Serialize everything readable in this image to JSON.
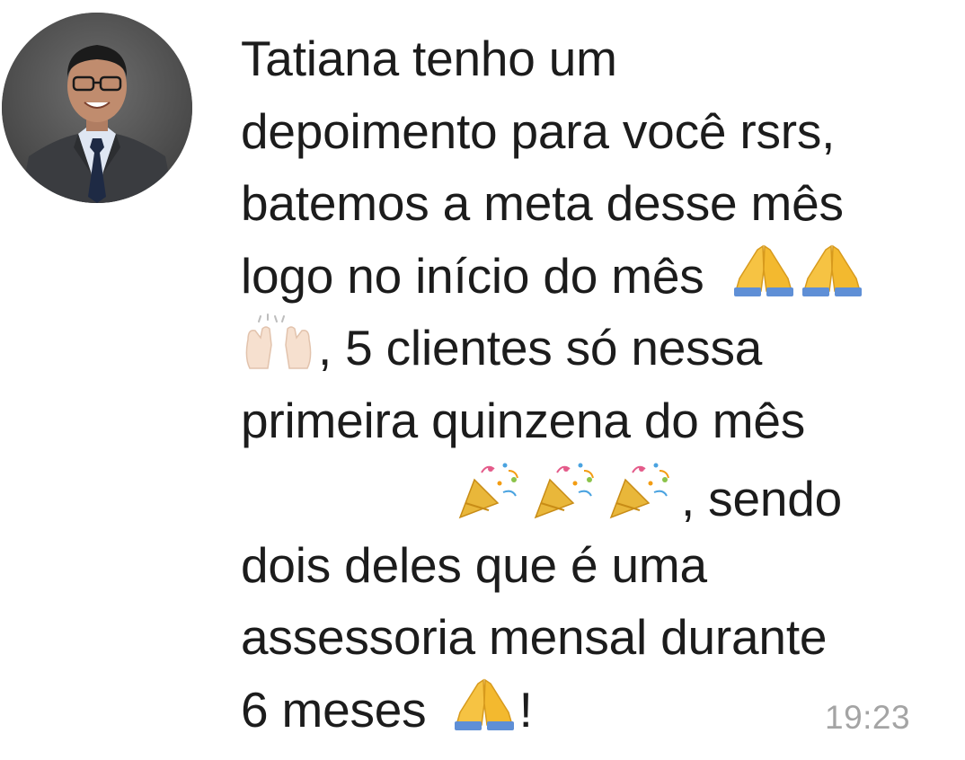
{
  "message": {
    "lines": [
      "Tatiana tenho um",
      "depoimento para você rsrs,",
      "batemos a meta desse mês",
      "logo no início do mês",
      ", 5 clientes só nessa",
      "primeira quinzena do mês",
      ", sendo",
      "dois deles que é uma",
      "assessoria mensal durante",
      "6 meses",
      "!"
    ],
    "emojis": [
      "folded-hands",
      "raising-hands",
      "party-popper"
    ],
    "timestamp": "19:23"
  },
  "colors": {
    "text": "#1c1c1c",
    "timestamp": "#a4a4a4",
    "background": "#ffffff"
  }
}
